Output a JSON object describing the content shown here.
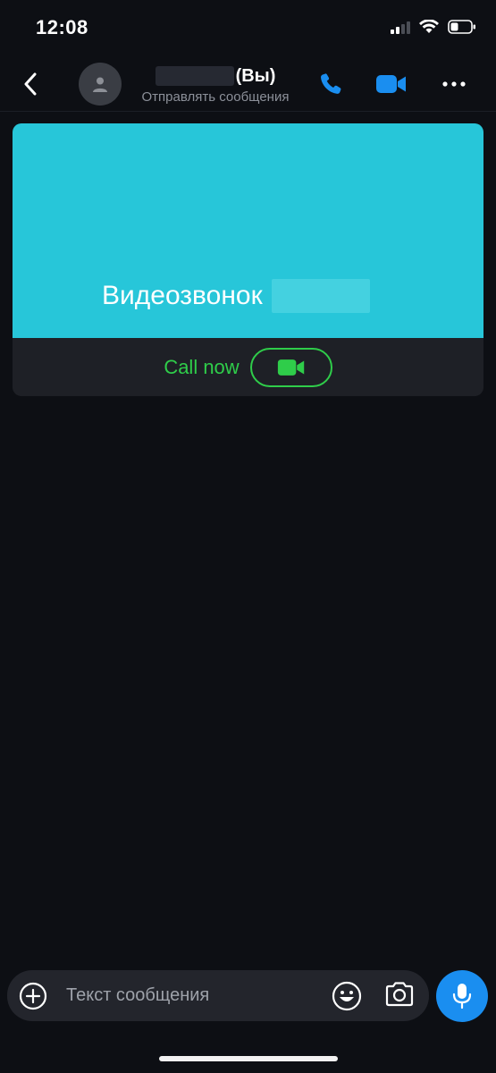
{
  "status_bar": {
    "time": "12:08"
  },
  "header": {
    "name_suffix": "(Вы)",
    "subtitle": "Отправлять сообщения",
    "accent_color": "#1a8ef0"
  },
  "call_card": {
    "title": "Видеозвонок",
    "call_now_label": "Call now",
    "top_color": "#27c6d9",
    "action_color": "#2fcd4a"
  },
  "composer": {
    "placeholder": "Текст сообщения"
  }
}
